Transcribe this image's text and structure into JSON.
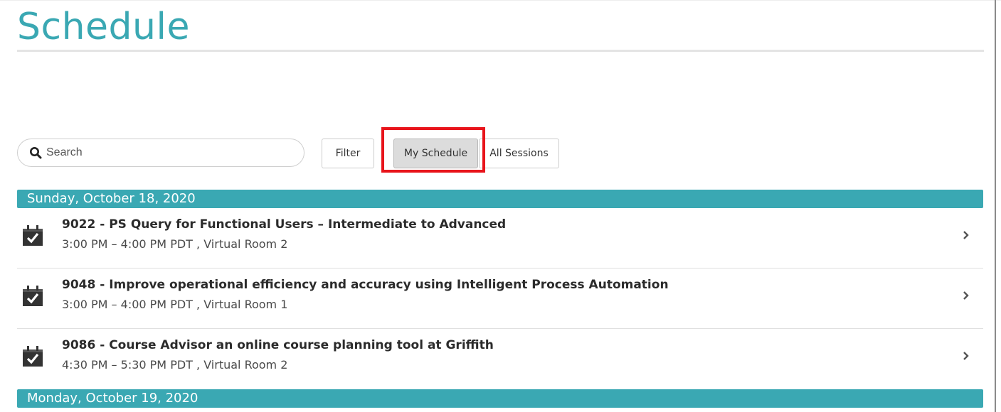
{
  "page": {
    "title": "Schedule"
  },
  "search": {
    "placeholder": "Search",
    "icon": "search-icon"
  },
  "toolbar": {
    "filter_label": "Filter",
    "my_schedule_label": "My Schedule",
    "all_sessions_label": "All Sessions"
  },
  "colors": {
    "accent": "#3aa8b3",
    "highlight": "#e8141b"
  },
  "days": [
    {
      "label": "Sunday, October 18, 2020",
      "sessions": [
        {
          "title": "9022 - PS Query for Functional Users – Intermediate to Advanced",
          "time": "3:00 PM – 4:00 PM PDT , Virtual Room 2"
        },
        {
          "title": "9048 - Improve operational efficiency and accuracy using Intelligent Process Automation",
          "time": "3:00 PM – 4:00 PM PDT , Virtual Room 1"
        },
        {
          "title": "9086 - Course Advisor an online course planning tool at Griffith",
          "time": "4:30 PM – 5:30 PM PDT , Virtual Room 2"
        }
      ]
    },
    {
      "label": "Monday, October 19, 2020",
      "sessions": []
    }
  ]
}
